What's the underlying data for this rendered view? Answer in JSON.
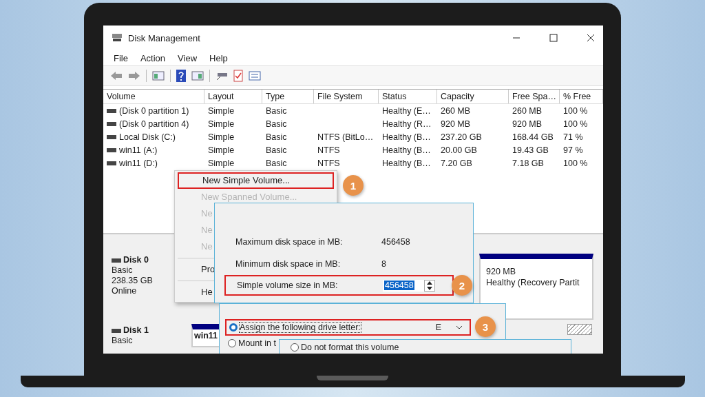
{
  "window": {
    "title": "Disk Management"
  },
  "menu": [
    "File",
    "Action",
    "View",
    "Help"
  ],
  "table": {
    "columns": [
      "Volume",
      "Layout",
      "Type",
      "File System",
      "Status",
      "Capacity",
      "Free Spa…",
      "% Free"
    ],
    "rows": [
      {
        "volume": "(Disk 0 partition 1)",
        "layout": "Simple",
        "type": "Basic",
        "status": "Healthy (E…",
        "capacity": "260 MB",
        "free": "260 MB",
        "pct": "100 %"
      },
      {
        "volume": "(Disk 0 partition 4)",
        "layout": "Simple",
        "type": "Basic",
        "status": "Healthy (R…",
        "capacity": "920 MB",
        "free": "920 MB",
        "pct": "100 %"
      },
      {
        "volume": "Local Disk (C:)",
        "layout": "Simple",
        "type": "Basic",
        "file_system": "NTFS (BitLo…",
        "status": "Healthy (B…",
        "capacity": "237.20 GB",
        "free": "168.44 GB",
        "pct": "71 %"
      },
      {
        "volume": "win11 (A:)",
        "layout": "Simple",
        "type": "Basic",
        "file_system": "NTFS",
        "status": "Healthy (B…",
        "capacity": "20.00 GB",
        "free": "19.43 GB",
        "pct": "97 %"
      },
      {
        "volume": "win11 (D:)",
        "layout": "Simple",
        "type": "Basic",
        "file_system": "NTFS",
        "status": "Healthy (B…",
        "capacity": "7.20 GB",
        "free": "7.18 GB",
        "pct": "100 %"
      }
    ]
  },
  "disks": [
    {
      "name": "Disk 0",
      "type": "Basic",
      "size": "238.35 GB",
      "status": "Online",
      "partitions": [
        {
          "size": "920 MB",
          "status": "Healthy (Recovery Partit"
        }
      ]
    },
    {
      "name": "Disk 1",
      "type": "Basic",
      "partitions": [
        {
          "label": "win11"
        }
      ]
    }
  ],
  "context_menu": {
    "items": [
      {
        "label": "New Simple Volume...",
        "disabled": false,
        "callout": "1"
      },
      {
        "label": "New Spanned Volume...",
        "disabled": true
      },
      {
        "label": "Ne",
        "disabled": true
      },
      {
        "label": "Ne",
        "disabled": true
      },
      {
        "label": "Ne",
        "disabled": true,
        "separator_after": true
      },
      {
        "label": "Pro",
        "disabled": false,
        "separator_after": true
      },
      {
        "label": "He",
        "disabled": false
      }
    ]
  },
  "size_dialog": {
    "rows": [
      {
        "label": "Maximum disk space in MB:",
        "value": "456458"
      },
      {
        "label": "Minimum disk space in MB:",
        "value": "8"
      }
    ],
    "size_field": {
      "label": "Simple volume size in MB:",
      "value": "456458",
      "callout": "2"
    }
  },
  "letter_dialog": {
    "options": [
      {
        "label": "Assign the following drive letter:",
        "selected": true,
        "dropdown": "E",
        "callout": "3"
      },
      {
        "label": "Mount in t",
        "selected": false
      }
    ]
  },
  "format_dialog": {
    "options": [
      {
        "label": "Do not format this volume",
        "selected": false
      }
    ]
  }
}
